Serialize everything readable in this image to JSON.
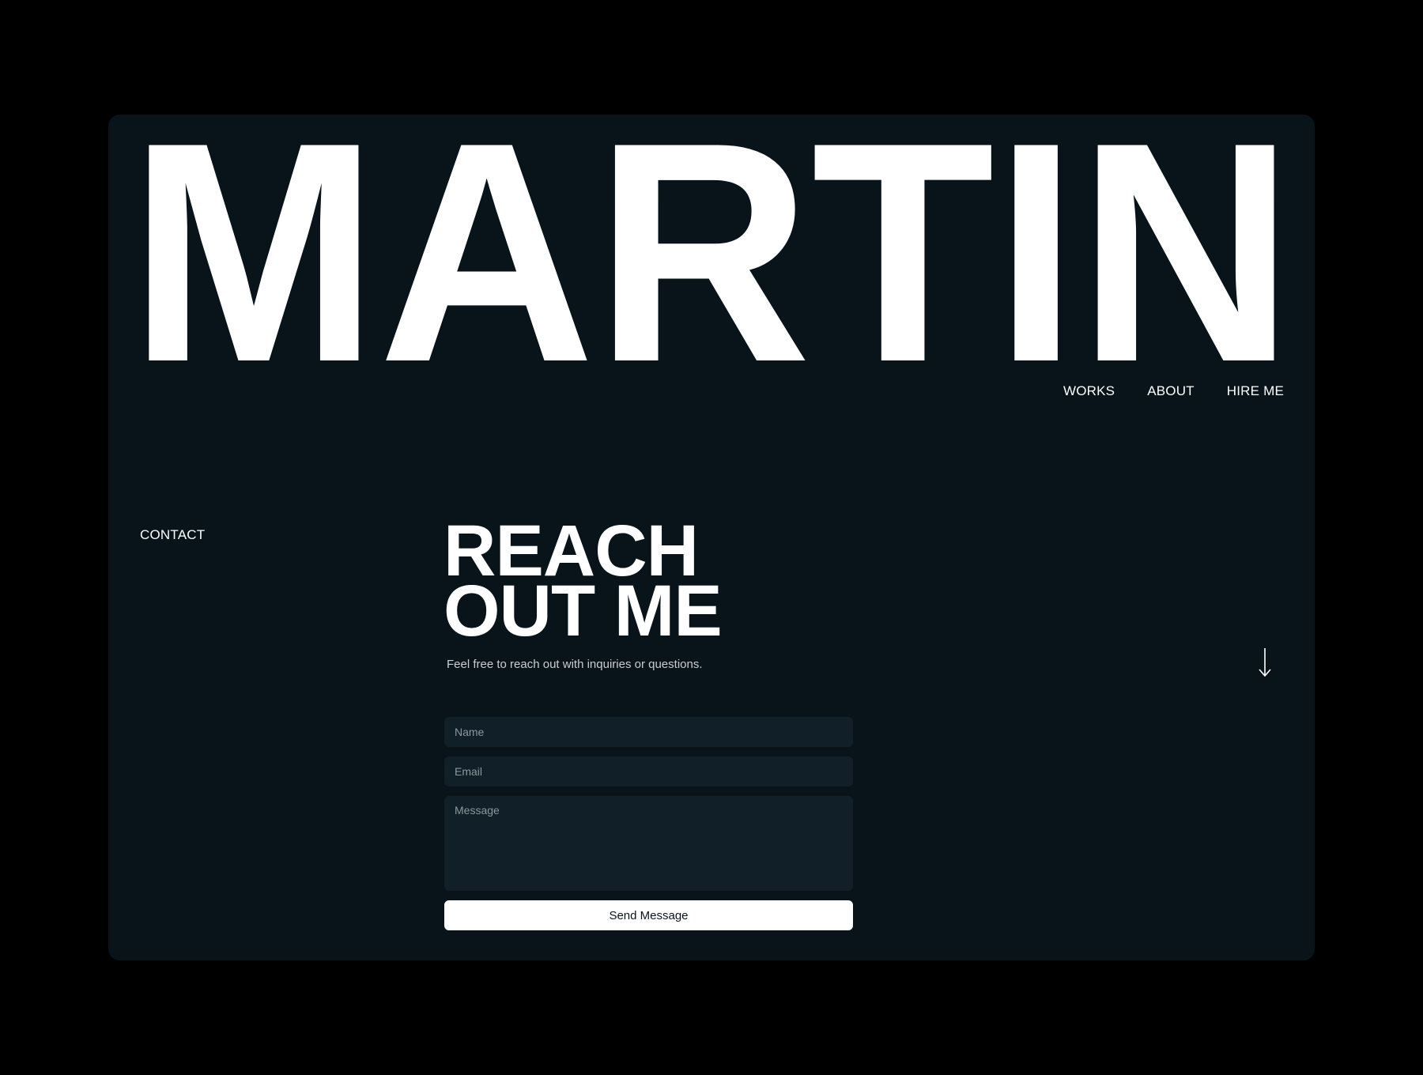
{
  "brand": {
    "name": "MARTIN"
  },
  "nav": {
    "items": [
      {
        "label": "WORKS"
      },
      {
        "label": "ABOUT"
      },
      {
        "label": "HIRE ME"
      }
    ]
  },
  "section": {
    "label": "CONTACT"
  },
  "hero": {
    "line1": "REACH",
    "line2": "OUT ME",
    "subtitle": "Feel free to reach out with inquiries or questions."
  },
  "form": {
    "name_placeholder": "Name",
    "email_placeholder": "Email",
    "message_placeholder": "Message",
    "submit_label": "Send Message"
  },
  "icons": {
    "scroll": "arrow-down-icon"
  },
  "colors": {
    "page_background": "#000000",
    "panel_background": "#08131a",
    "field_background": "#111f28",
    "text": "#ffffff",
    "button_background": "#ffffff",
    "button_text": "#0b141a"
  }
}
